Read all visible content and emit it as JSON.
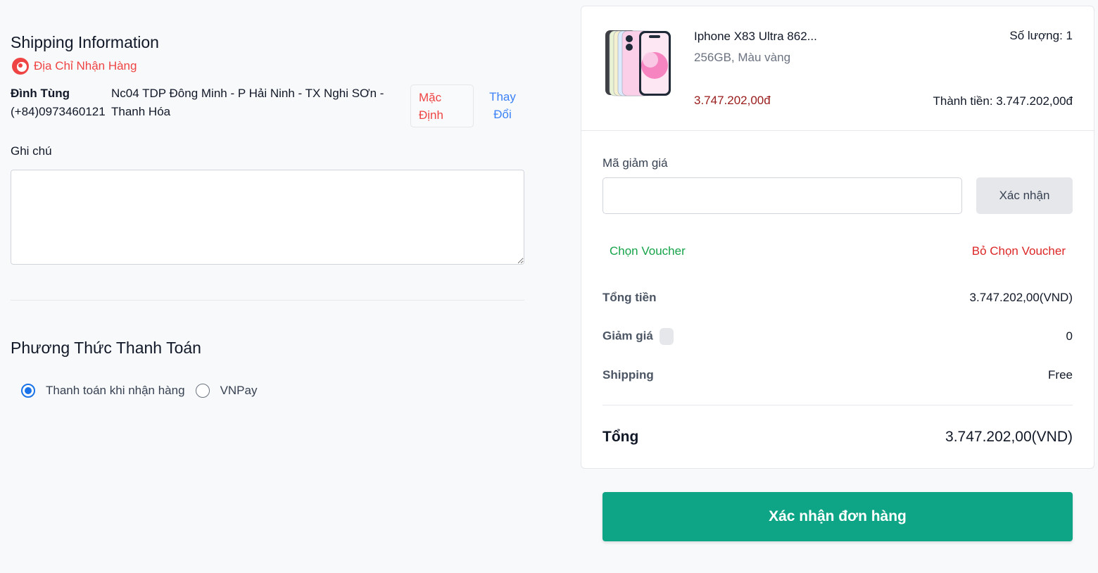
{
  "shipping": {
    "title": "Shipping Information",
    "address_heading": "Địa Chỉ Nhận Hàng",
    "recipient_name": "Đình Tùng",
    "recipient_phone": "(+84)0973460121",
    "address": "Nc04 TDP Đông Minh - P Hải Ninh - TX Nghi SƠn - Thanh Hóa",
    "default_label": "Mặc Định",
    "change_label": "Thay Đổi",
    "note_label": "Ghi chú",
    "note_value": ""
  },
  "payment": {
    "title": "Phương Thức Thanh Toán",
    "options": [
      {
        "label": "Thanh toán khi nhận hàng",
        "selected": true
      },
      {
        "label": "VNPay",
        "selected": false
      }
    ]
  },
  "product": {
    "name": "Iphone X83 Ultra 862...",
    "variant": "256GB, Màu vàng",
    "price": "3.747.202,00đ",
    "quantity_text": "Số lượng: 1",
    "line_total_text": "Thành tiền: 3.747.202,00đ",
    "image_icon": "pink-iphone-image"
  },
  "coupon": {
    "label": "Mã giảm giá",
    "input_value": "",
    "confirm_label": "Xác nhận",
    "choose_voucher": "Chọn Voucher",
    "remove_voucher": "Bỏ Chọn Voucher"
  },
  "summary": {
    "subtotal_label": "Tổng tiền",
    "subtotal_value": "3.747.202,00(VND)",
    "discount_label": "Giảm giá",
    "discount_value": "0",
    "shipping_label": "Shipping",
    "shipping_value": "Free",
    "total_label": "Tổng",
    "total_value": "3.747.202,00(VND)"
  },
  "actions": {
    "confirm_order": "Xác nhận đơn hàng"
  },
  "colors": {
    "accent_green": "#0ea586",
    "danger_red": "#ef4444",
    "link_blue": "#3b82f6",
    "price_red": "#991b1b"
  }
}
